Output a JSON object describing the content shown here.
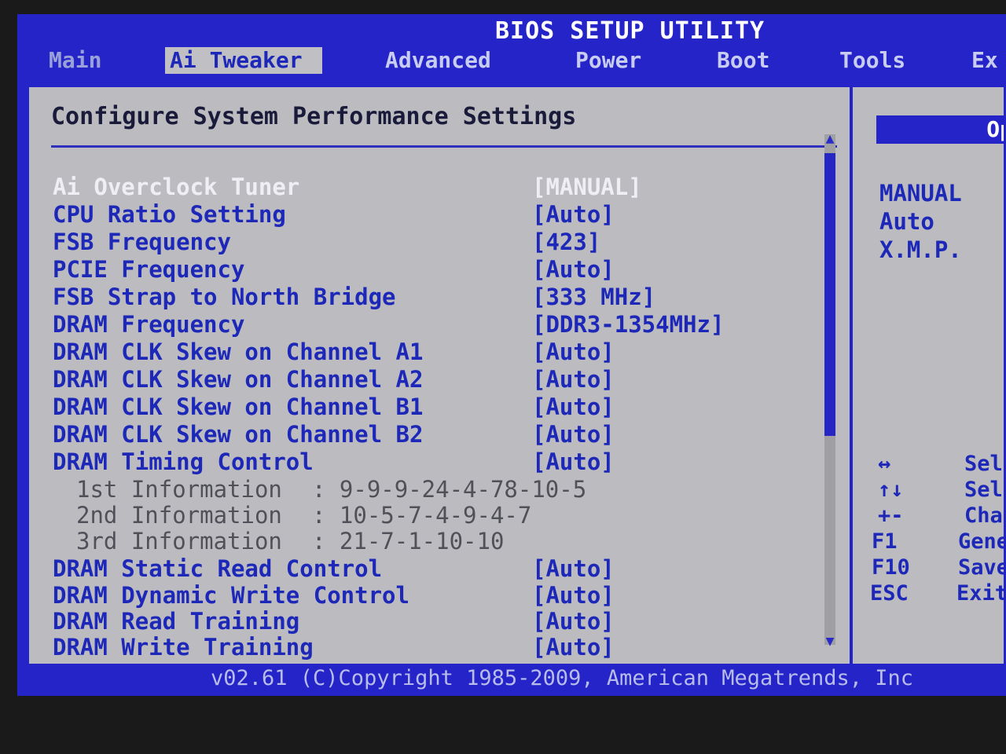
{
  "title": "BIOS SETUP UTILITY",
  "tabs": [
    {
      "label": "Main"
    },
    {
      "label": "Ai Tweaker"
    },
    {
      "label": "Advanced"
    },
    {
      "label": "Power"
    },
    {
      "label": "Boot"
    },
    {
      "label": "Tools"
    },
    {
      "label": "Ex"
    }
  ],
  "active_tab": "Ai Tweaker",
  "main": {
    "heading": "Configure System Performance Settings",
    "settings": [
      {
        "label": "Ai Overclock Tuner",
        "value": "[MANUAL]"
      },
      {
        "label": "CPU Ratio Setting",
        "value": "[Auto]"
      },
      {
        "label": "FSB Frequency",
        "value": "[423]"
      },
      {
        "label": "PCIE Frequency",
        "value": "[Auto]"
      },
      {
        "label": "FSB Strap to North Bridge",
        "value": "[333 MHz]"
      },
      {
        "label": "DRAM Frequency",
        "value": "[DDR3-1354MHz]"
      },
      {
        "label": "DRAM CLK Skew on Channel A1",
        "value": "[Auto]"
      },
      {
        "label": "DRAM CLK Skew on Channel A2",
        "value": "[Auto]"
      },
      {
        "label": "DRAM CLK Skew on Channel B1",
        "value": "[Auto]"
      },
      {
        "label": "DRAM CLK Skew on Channel B2",
        "value": "[Auto]"
      },
      {
        "label": "DRAM Timing Control",
        "value": "[Auto]"
      }
    ],
    "info": [
      {
        "label": "1st Information",
        "value": ": 9-9-9-24-4-78-10-5"
      },
      {
        "label": "2nd Information",
        "value": ": 10-5-7-4-9-4-7"
      },
      {
        "label": "3rd Information",
        "value": ": 21-7-1-10-10"
      }
    ],
    "settings2": [
      {
        "label": "DRAM Static Read Control",
        "value": "[Auto]"
      },
      {
        "label": "DRAM Dynamic Write Control",
        "value": "[Auto]"
      },
      {
        "label": "DRAM Read Training",
        "value": "[Auto]"
      },
      {
        "label": "DRAM Write Training",
        "value": "[Auto]"
      }
    ]
  },
  "help": {
    "header": "Op",
    "options": [
      "MANUAL",
      "Auto",
      "X.M.P."
    ],
    "keys": [
      {
        "key": "↔",
        "desc": "Selec"
      },
      {
        "key": "↑↓",
        "desc": "Selec"
      },
      {
        "key": "+-",
        "desc": "Chang"
      },
      {
        "key": "F1",
        "desc": "Gener"
      },
      {
        "key": "F10",
        "desc": "Save"
      },
      {
        "key": "ESC",
        "desc": "Exit"
      }
    ]
  },
  "footer": "v02.61 (C)Copyright 1985-2009, American Megatrends, Inc",
  "colors": {
    "bios_blue": "#2424c8",
    "panel_grey": "#bcbcc0",
    "text_blue": "#1d28b8",
    "selected_white": "#eeeef4"
  }
}
